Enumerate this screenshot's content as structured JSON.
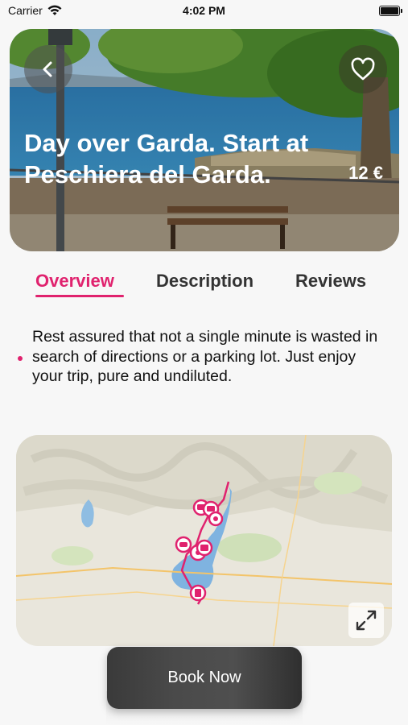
{
  "status_bar": {
    "carrier": "Carrier",
    "time": "4:02 PM"
  },
  "hero": {
    "title": "Day over Garda. Start at Peschiera del Garda.",
    "price": "12 €",
    "back_icon": "chevron-left-icon",
    "favorite_icon": "heart-icon"
  },
  "tabs": [
    {
      "label": "Overview",
      "active": true
    },
    {
      "label": "Description",
      "active": false
    },
    {
      "label": "Reviews",
      "active": false
    }
  ],
  "overview": {
    "text": "Rest assured that not a single minute is wasted in search of directions or a parking lot. Just enjoy your trip, pure and undiluted."
  },
  "map": {
    "expand_icon": "expand-arrows-icon",
    "pins": [
      {
        "icon": "camera-icon"
      },
      {
        "icon": "camera-icon"
      },
      {
        "icon": "pin-icon"
      },
      {
        "icon": "car-icon"
      },
      {
        "icon": "pin-icon"
      },
      {
        "icon": "pin-icon"
      },
      {
        "icon": "pin-icon"
      }
    ]
  },
  "actions": {
    "book_now": "Book Now"
  },
  "colors": {
    "accent": "#e0226e",
    "button": "#444444",
    "lake": "#7fb3e0"
  }
}
